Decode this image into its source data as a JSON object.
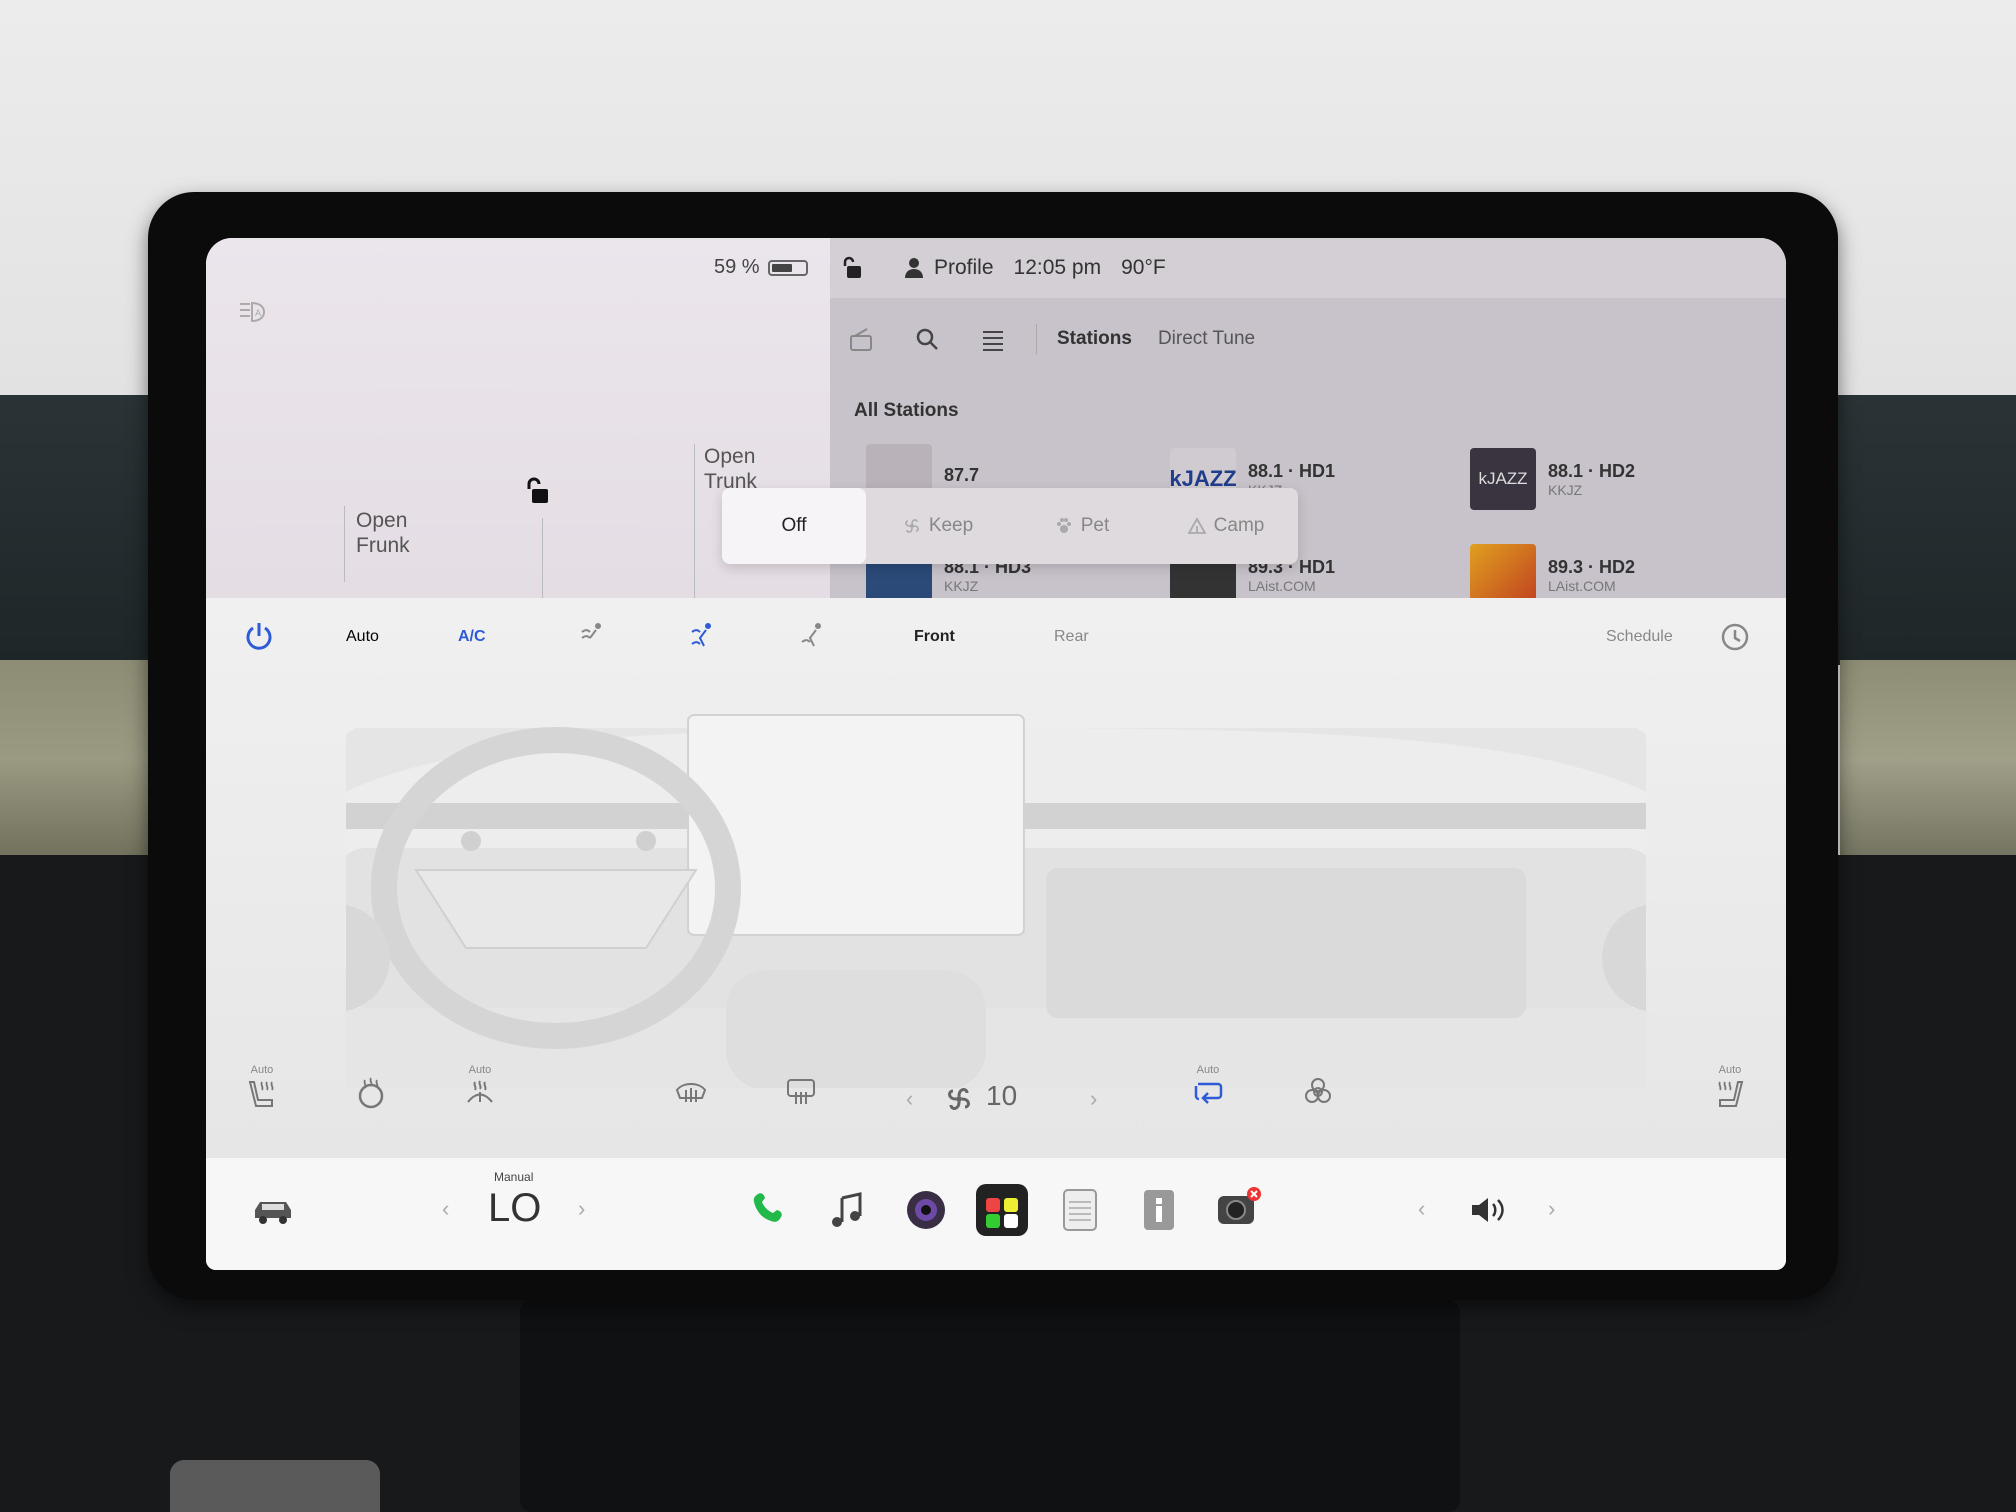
{
  "status": {
    "battery_percent": "59 %",
    "profile": "Profile",
    "time": "12:05 pm",
    "temperature": "90°F"
  },
  "car": {
    "open_frunk": "Open\nFrunk",
    "open_frunk_l1": "Open",
    "open_frunk_l2": "Frunk",
    "open_trunk_l1": "Open",
    "open_trunk_l2": "Trunk"
  },
  "media": {
    "tabs": [
      "Stations",
      "Direct Tune"
    ],
    "section": "All Stations",
    "stations": [
      {
        "freq": "87.7",
        "sub": ""
      },
      {
        "freq": "88.1 · HD1",
        "sub": "KKJZ"
      },
      {
        "freq": "88.1 · HD2",
        "sub": "KKJZ"
      },
      {
        "freq": "88.1 · HD3",
        "sub": "KKJZ"
      },
      {
        "freq": "89.3 · HD1",
        "sub": "LAist.COM"
      },
      {
        "freq": "89.3 · HD2",
        "sub": "LAist.COM"
      }
    ]
  },
  "climate_modes": {
    "options": [
      "Off",
      "Keep",
      "Pet",
      "Camp"
    ],
    "selected": "Off"
  },
  "climate": {
    "auto": "Auto",
    "ac": "A/C",
    "front": "Front",
    "rear": "Rear",
    "schedule": "Schedule",
    "fan_speed": "10",
    "seat_auto_tag": "Auto",
    "accent": "#2f5bd6"
  },
  "bottom_bar": {
    "temp_mode": "Manual",
    "temp_value": "LO",
    "apps": [
      "phone-icon",
      "music-icon",
      "camera-icon",
      "toybox-icon",
      "calendar-icon",
      "manual-icon",
      "dashcam-icon"
    ]
  }
}
